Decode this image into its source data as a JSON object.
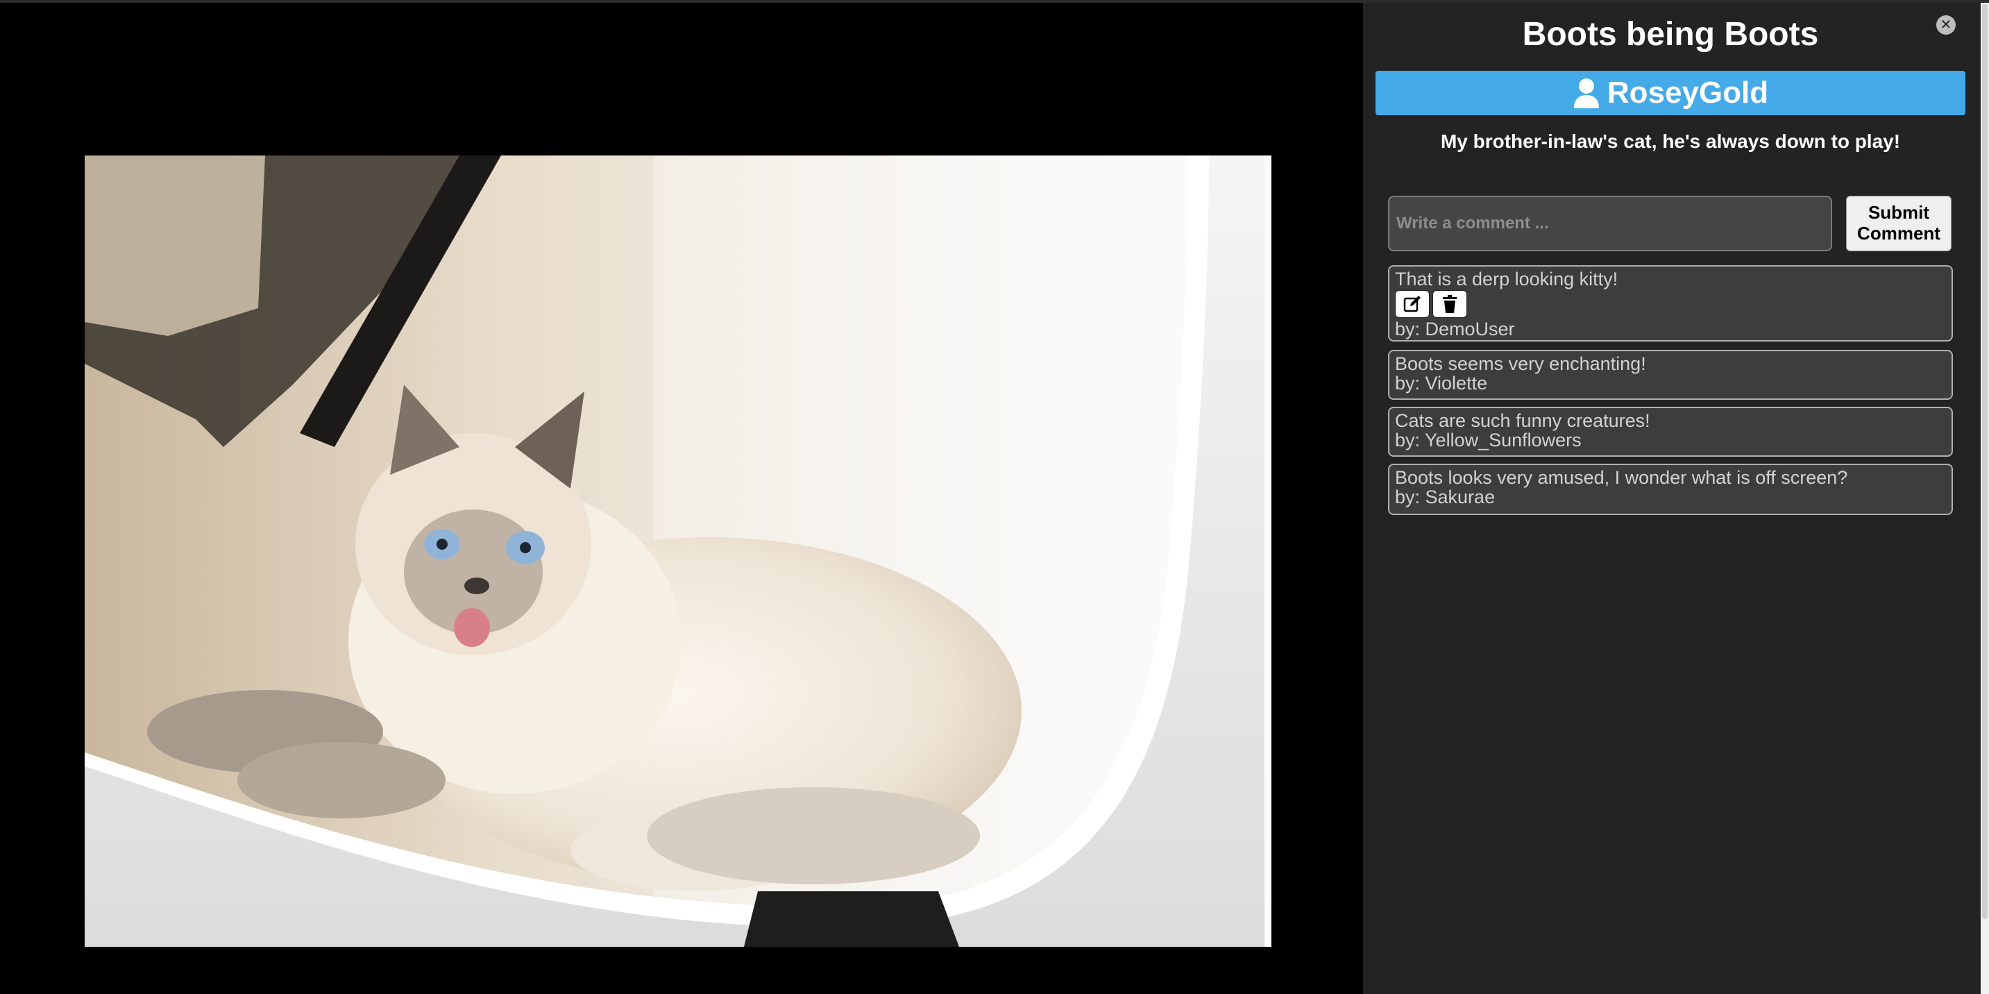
{
  "post": {
    "title": "Boots being Boots",
    "author": "RoseyGold",
    "description": "My brother-in-law's cat, he's always down to play!"
  },
  "comment_form": {
    "placeholder": "Write a comment ...",
    "submit_label": "Submit Comment"
  },
  "comments": [
    {
      "text": "That is a derp looking kitty!",
      "byline": "by: DemoUser",
      "editable": true
    },
    {
      "text": "Boots seems very enchanting!",
      "byline": "by: Violette",
      "editable": false
    },
    {
      "text": "Cats are such funny creatures!",
      "byline": "by: Yellow_Sunflowers",
      "editable": false
    },
    {
      "text": "Boots looks very amused, I wonder what is off screen?",
      "byline": "by: Sakurae",
      "editable": false
    }
  ],
  "icons": {
    "close": "close-icon",
    "author": "user-icon",
    "edit": "edit-icon",
    "delete": "trash-icon"
  },
  "colors": {
    "author_bar": "#45aae8",
    "panel_bg": "#232323",
    "comment_bg": "#3d3d3d"
  }
}
